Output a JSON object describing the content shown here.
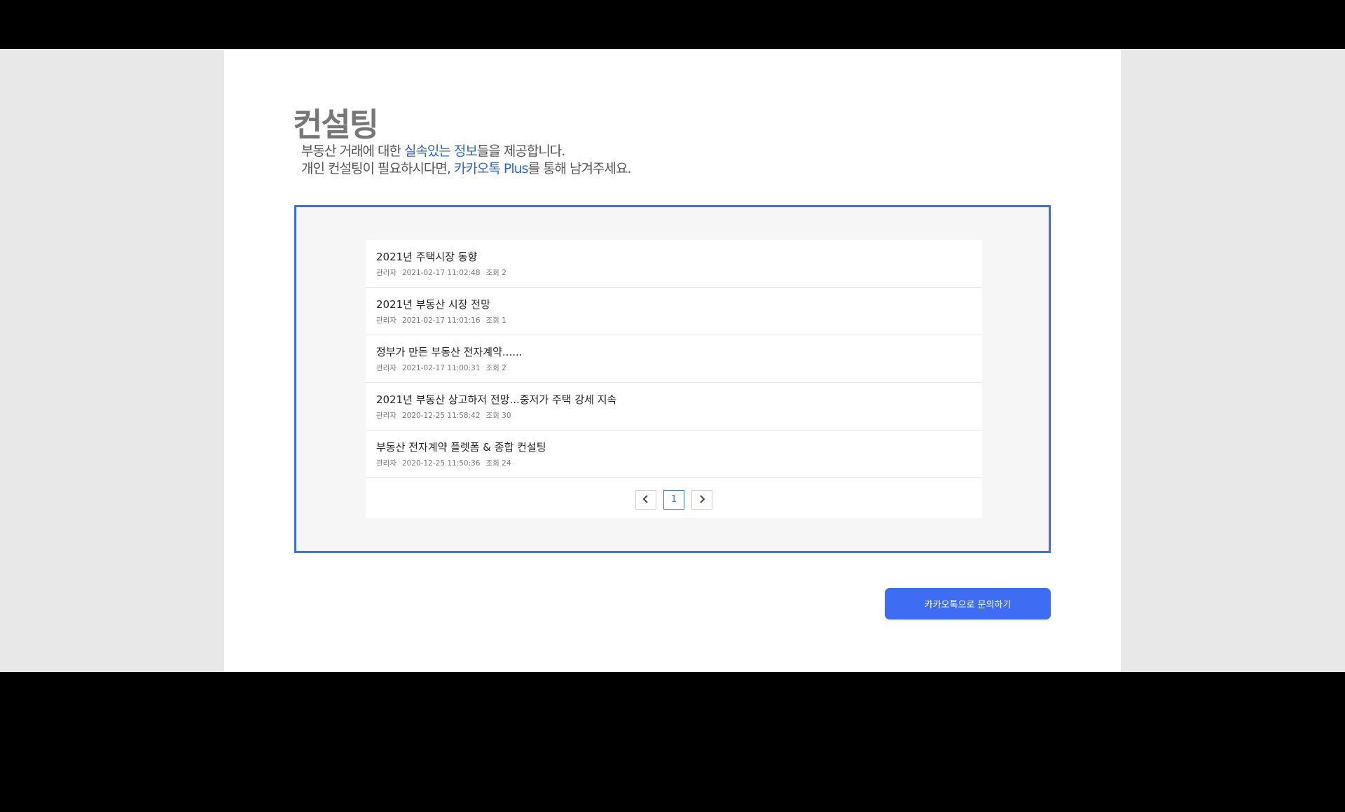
{
  "header": {
    "title": "컨설팅",
    "desc_line1": {
      "pre": "부동산 거래에 대한 ",
      "highlight": "실속있는 정보",
      "post": "들을 제공합니다."
    },
    "desc_line2": {
      "pre": "개인 컨설팅이 필요하시다면, ",
      "highlight": "카카오톡 Plus",
      "post": "를 통해 남겨주세요."
    }
  },
  "posts": [
    {
      "title": "2021년 주택시장 동향",
      "author": "관리자",
      "date": "2021-02-17 11:02:48",
      "views": "조회 2"
    },
    {
      "title": "2021년 부동산 시장 전망",
      "author": "관리자",
      "date": "2021-02-17 11:01:16",
      "views": "조회 1"
    },
    {
      "title": "정부가 만든 부동산 전자계약......",
      "author": "관리자",
      "date": "2021-02-17 11:00:31",
      "views": "조회 2"
    },
    {
      "title": "2021년 부동산 상고하저 전망...중저가 주택 강세 지속",
      "author": "관리자",
      "date": "2020-12-25 11:58:42",
      "views": "조회 30"
    },
    {
      "title": "부동산 전자계약 플렛폼 & 종합 컨설팅",
      "author": "관리자",
      "date": "2020-12-25 11:50:36",
      "views": "조회 24"
    }
  ],
  "pagination": {
    "current": "1",
    "prev_icon": "chevron-left-icon",
    "next_icon": "chevron-right-icon"
  },
  "cta": {
    "label": "카카오톡으로 문의하기"
  },
  "colors": {
    "accent": "#3e6df3",
    "frame": "#3b6fe0",
    "highlight": "#2f63d6"
  }
}
